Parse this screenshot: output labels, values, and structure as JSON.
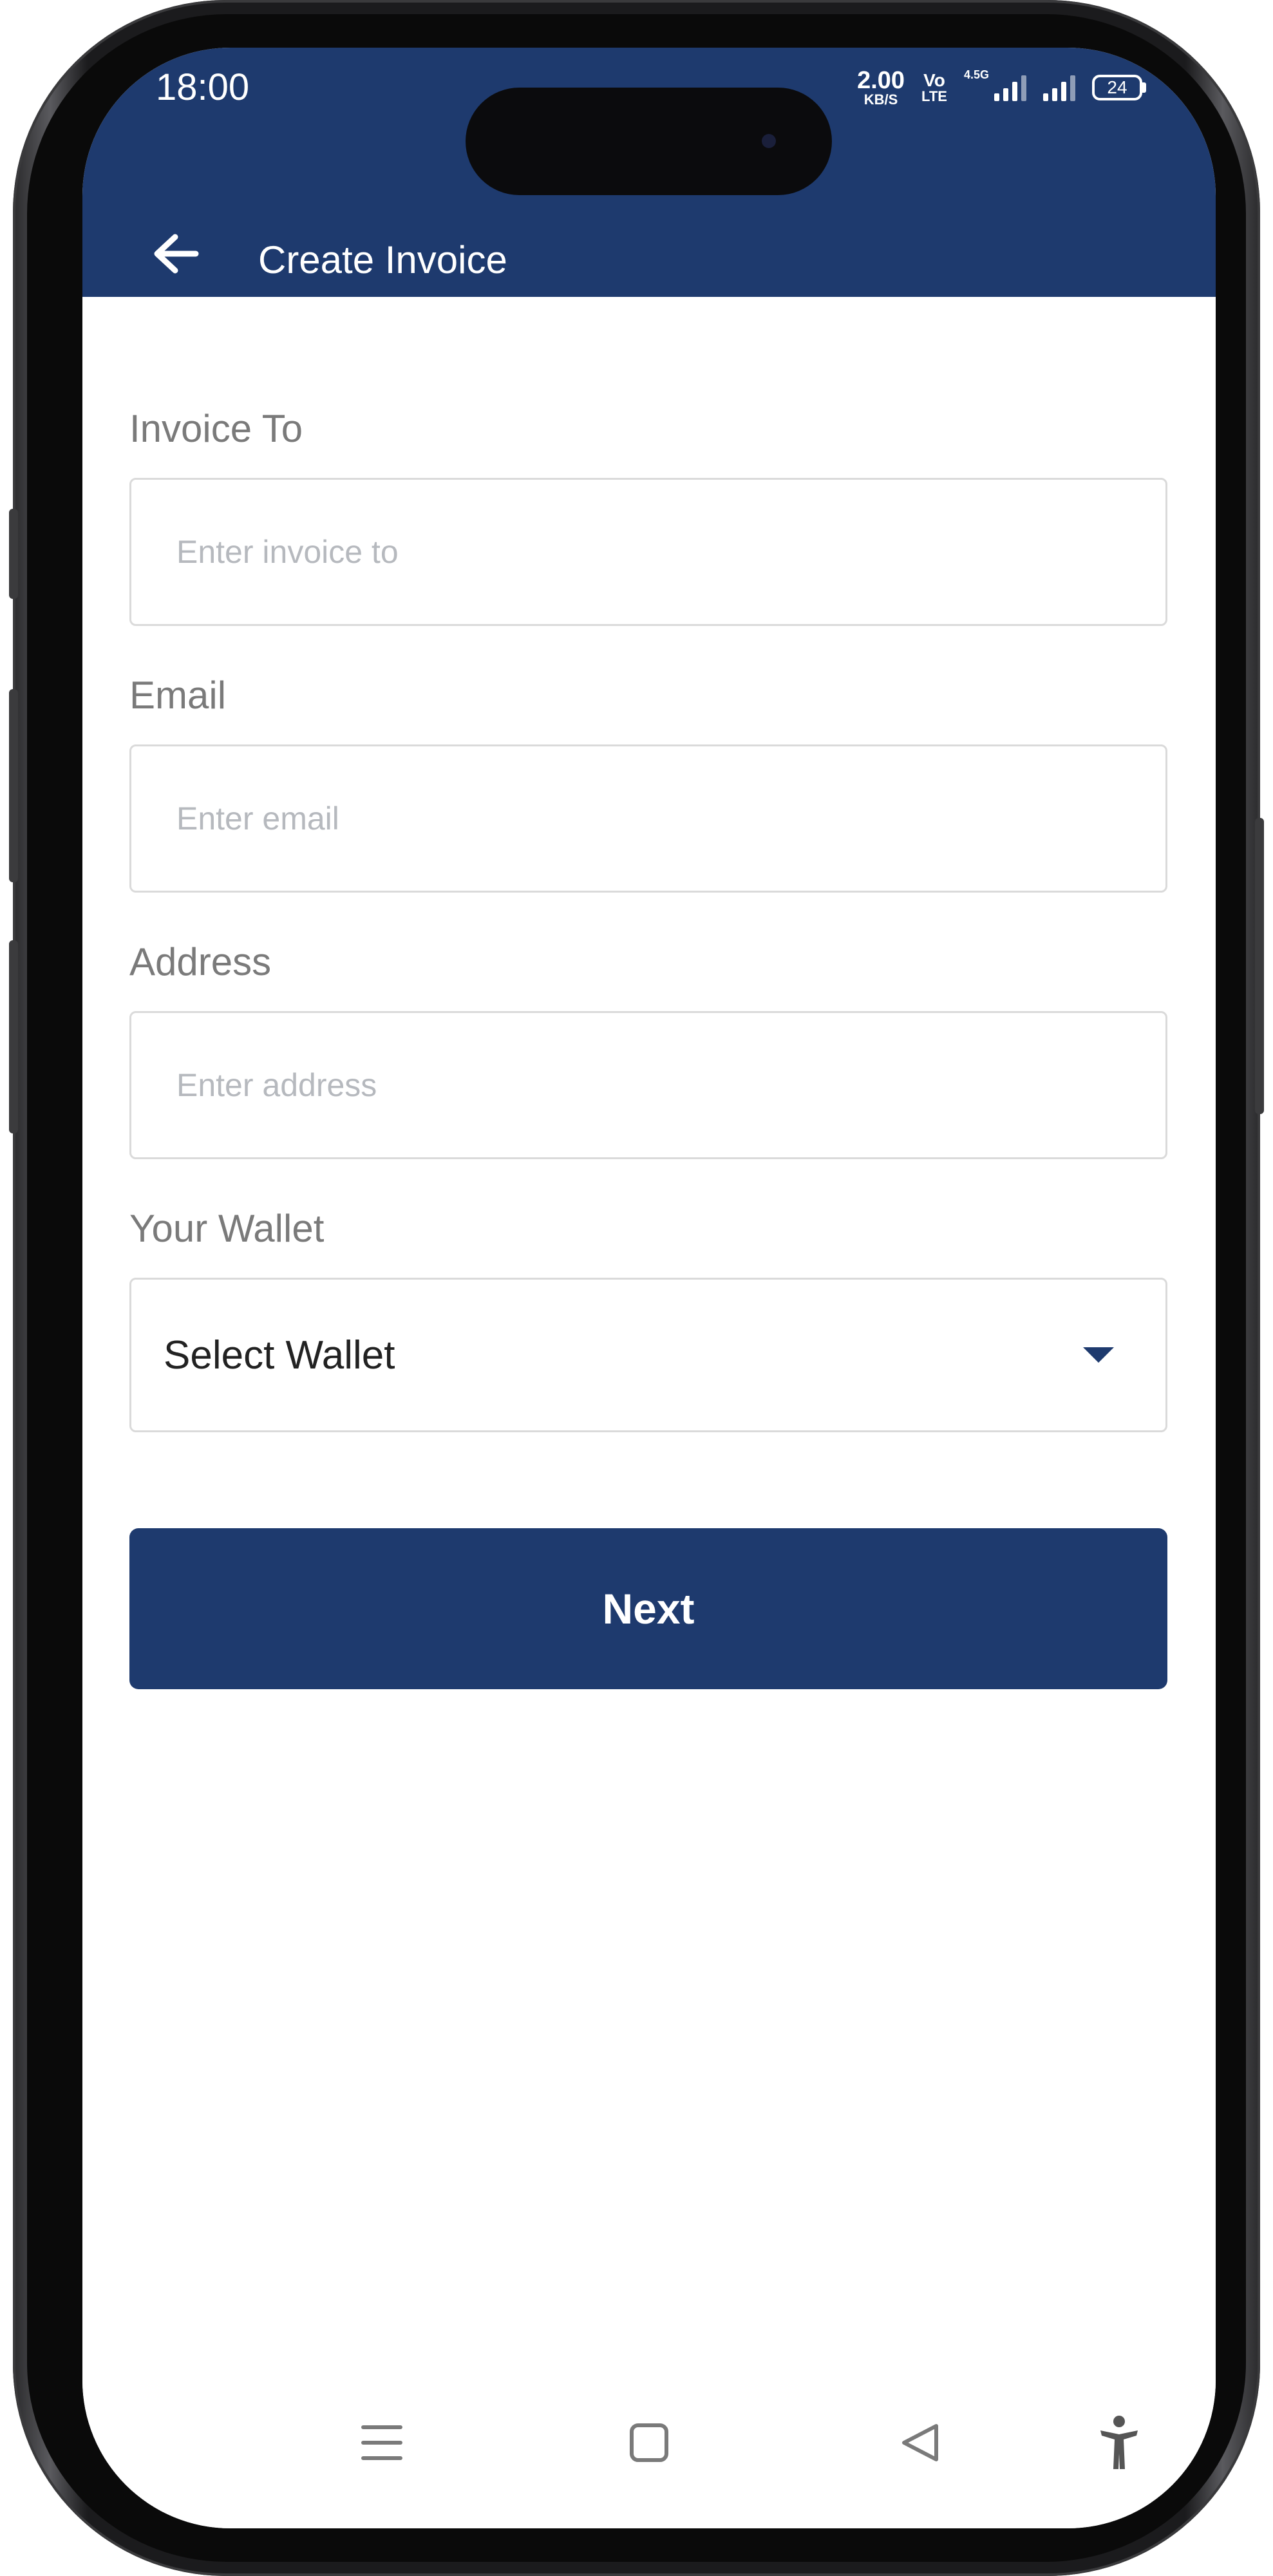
{
  "status_bar": {
    "time": "18:00",
    "net_speed_value": "2.00",
    "net_speed_unit": "KB/S",
    "volte_top": "Vo",
    "volte_bottom": "LTE",
    "network_type": "4.5G",
    "battery": "24"
  },
  "app_bar": {
    "title": "Create Invoice",
    "back_icon": "arrow-left-icon"
  },
  "form": {
    "invoice_to": {
      "label": "Invoice To",
      "placeholder": "Enter invoice to",
      "value": ""
    },
    "email": {
      "label": "Email",
      "placeholder": "Enter email",
      "value": ""
    },
    "address": {
      "label": "Address",
      "placeholder": "Enter address",
      "value": ""
    },
    "wallet": {
      "label": "Your Wallet",
      "selected": "Select Wallet",
      "icon": "caret-down-icon"
    },
    "next_label": "Next"
  },
  "nav_bar": {
    "icons": [
      "menu-icon",
      "home-square-icon",
      "back-triangle-icon",
      "accessibility-icon"
    ]
  },
  "colors": {
    "primary": "#1e3a6e",
    "label": "#7a7a7a",
    "placeholder": "#b6b9be",
    "border": "#dadada"
  }
}
